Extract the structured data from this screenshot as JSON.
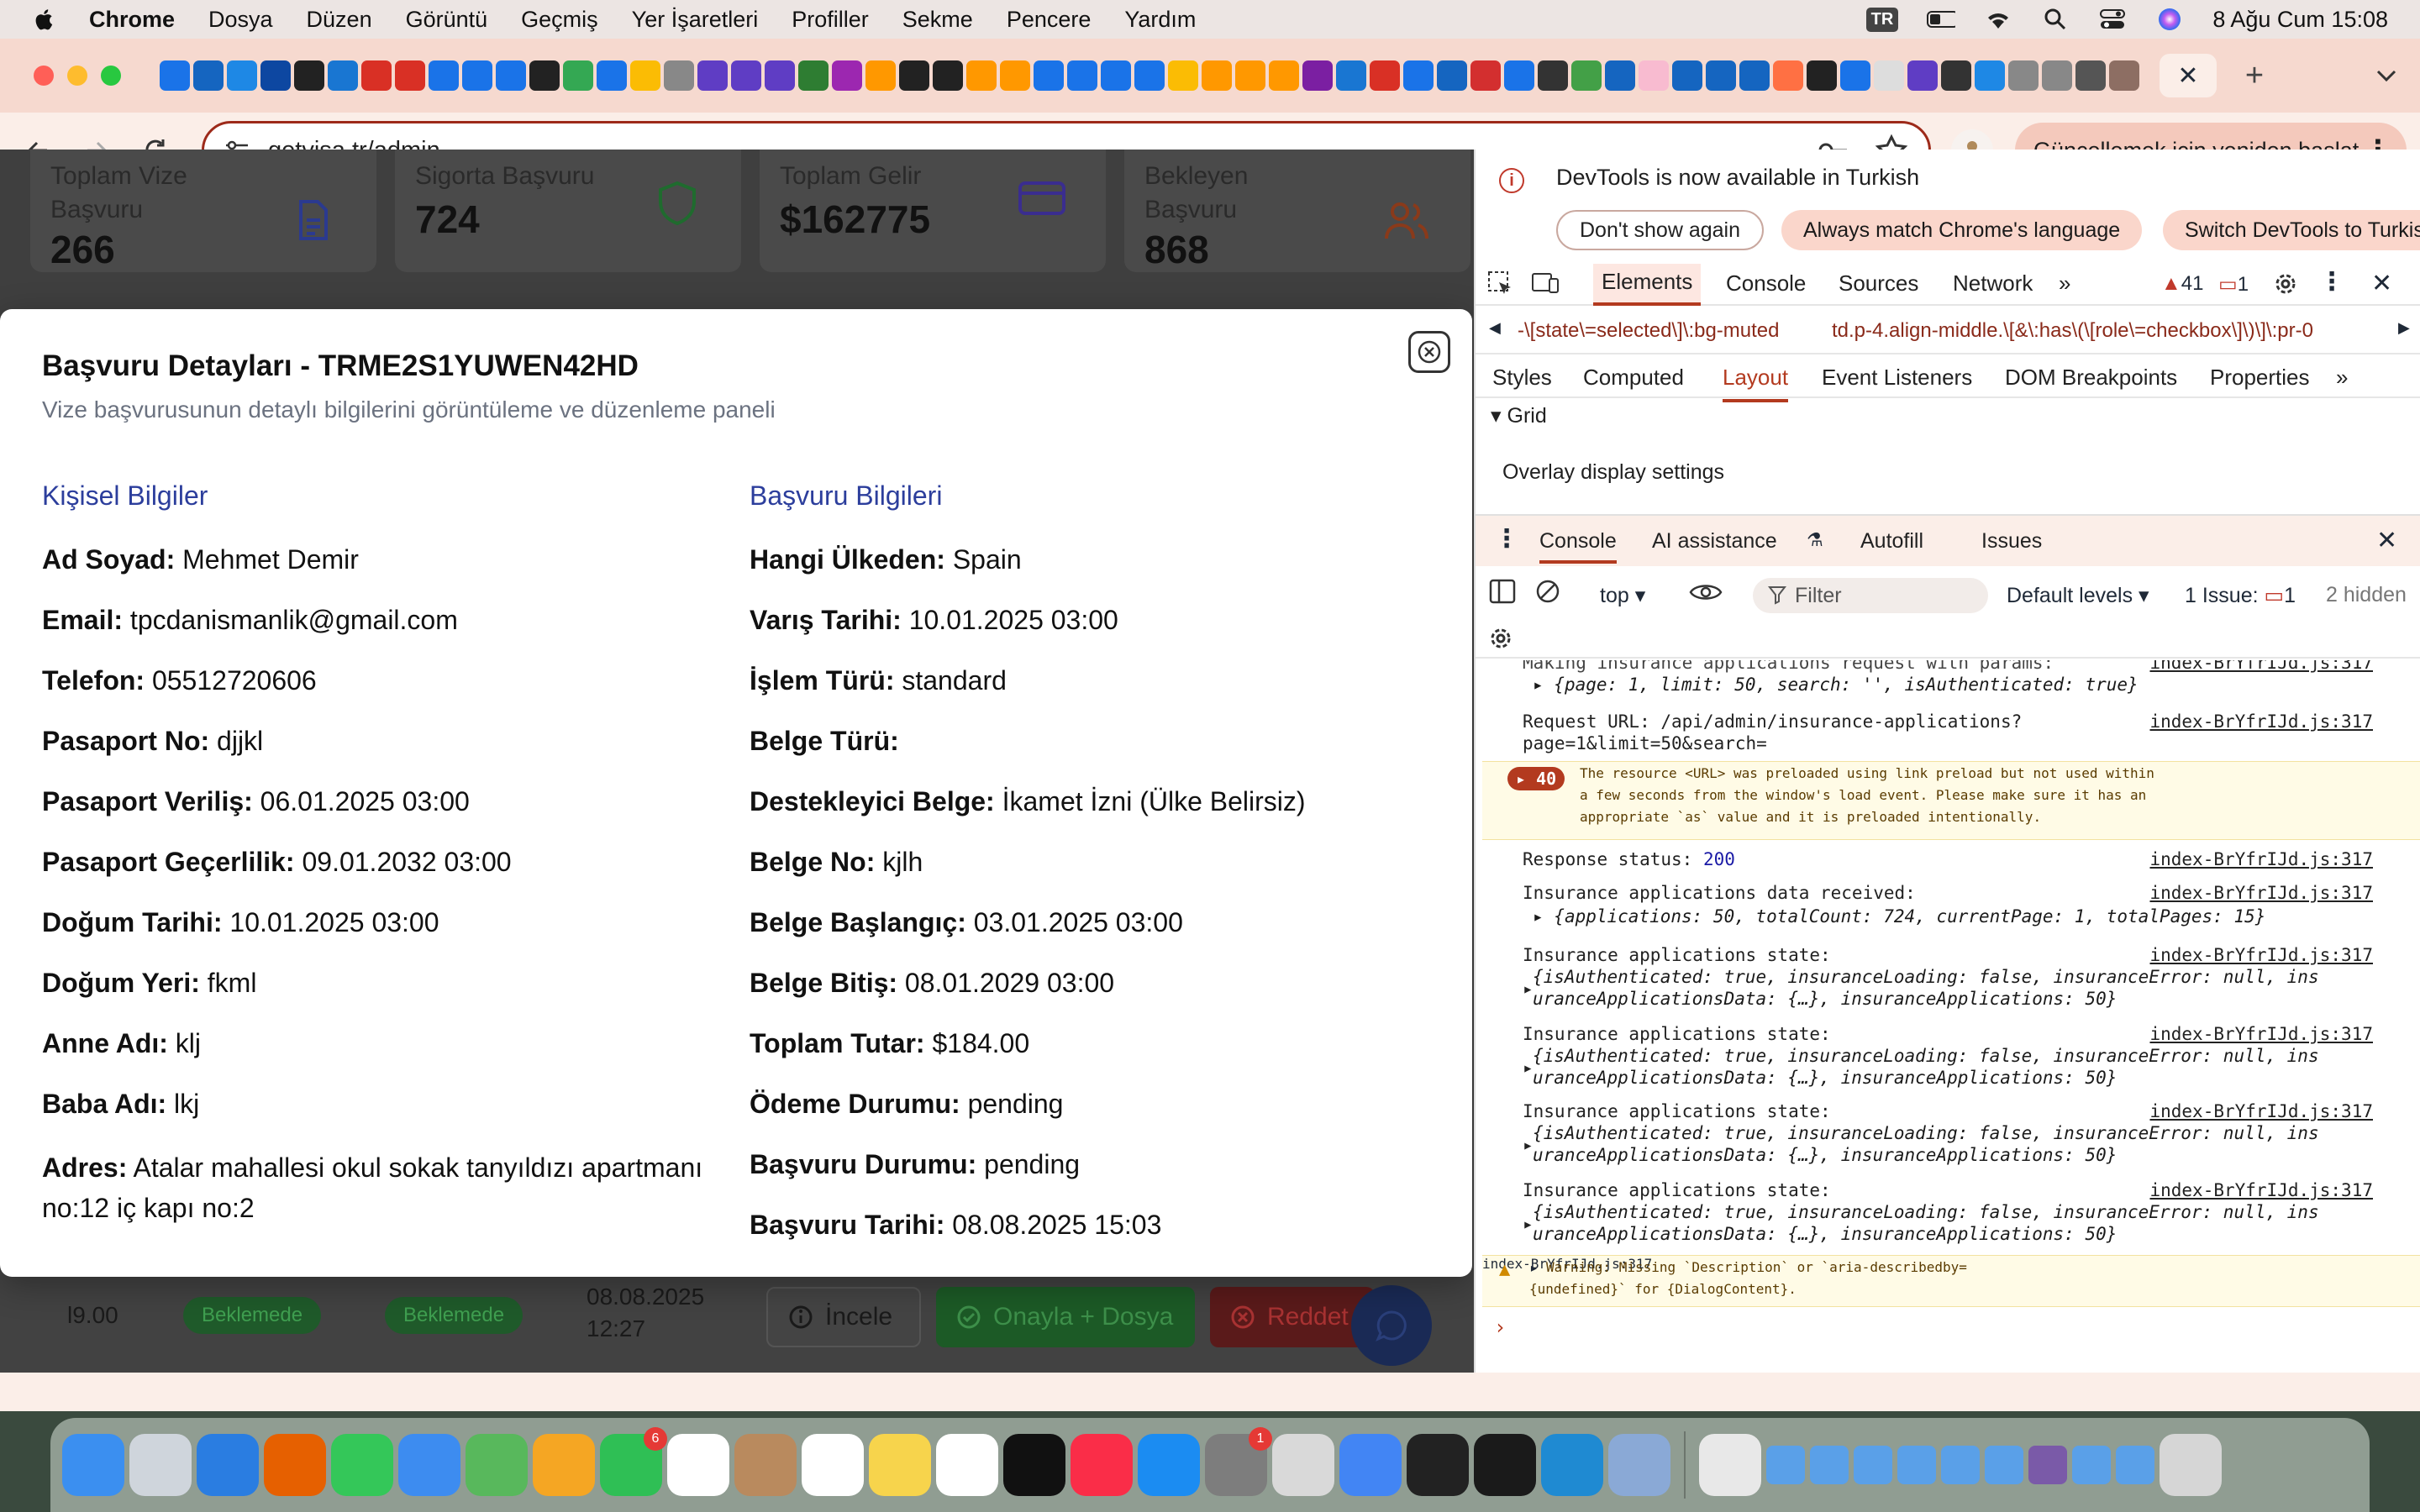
{
  "menubar": {
    "app_name": "Chrome",
    "items": [
      "Dosya",
      "Düzen",
      "Görüntü",
      "Geçmiş",
      "Yer İşaretleri",
      "Profiller",
      "Sekme",
      "Pencere",
      "Yardım"
    ],
    "input_source": "TR",
    "datetime": "8 Ağu Cum  15:08"
  },
  "browser": {
    "url": "getvisa.tr/admin",
    "relaunch_label": "Güncellemek için yeniden başlat",
    "favicon_colors": [
      "#1a73e8",
      "#1565c0",
      "#1e88e5",
      "#0d47a1",
      "#222",
      "#1976d2",
      "#d93025",
      "#d93025",
      "#1a73e8",
      "#1a73e8",
      "#1a73e8",
      "#222",
      "#34a853",
      "#1a73e8",
      "#fbbc04",
      "#888",
      "#5f3dc4",
      "#5f3dc4",
      "#5f3dc4",
      "#2e7d32",
      "#9c27b0",
      "#ff9800",
      "#222",
      "#222",
      "#ff9800",
      "#ff9800",
      "#1a73e8",
      "#1a73e8",
      "#1a73e8",
      "#1a73e8",
      "#fbbc04",
      "#ff9800",
      "#ff9800",
      "#ff9800",
      "#7b1fa2",
      "#1976d2",
      "#d93025",
      "#1a73e8",
      "#1565c0",
      "#d32f2f",
      "#1a73e8",
      "#333",
      "#43a047",
      "#1565c0",
      "#f8bbd0",
      "#1565c0",
      "#1565c0",
      "#1565c0",
      "#ff7043",
      "#222",
      "#1a73e8",
      "#ddd",
      "#5f3dc4",
      "#333",
      "#1e88e5",
      "#888",
      "#888",
      "#555",
      "#8d6e63"
    ]
  },
  "dashboard": {
    "stats": [
      {
        "label": "Toplam Vize Başvuru",
        "value": "266",
        "icon": "document-icon",
        "color": "#2b3a8f"
      },
      {
        "label": "Sigorta Başvuru",
        "value": "724",
        "icon": "shield-icon",
        "color": "#1f6b2e"
      },
      {
        "label": "Toplam Gelir",
        "value": "$162775",
        "icon": "credit-card-icon",
        "color": "#3a2d8f"
      },
      {
        "label": "Bekleyen Başvuru",
        "value": "868",
        "icon": "users-icon",
        "color": "#8a3a1a"
      }
    ],
    "row": {
      "amount": "l9.00",
      "payment_status": "Beklemede",
      "app_status": "Beklemede",
      "date": "08.08.2025",
      "time": "12:27",
      "btn_view": "İncele",
      "btn_approve": "Onayla + Dosya",
      "btn_reject": "Reddet"
    }
  },
  "modal": {
    "title": "Başvuru Detayları - TRME2S1YUWEN42HD",
    "subtitle": "Vize başvurusunun detaylı bilgilerini görüntüleme ve düzenleme paneli",
    "personal": {
      "heading": "Kişisel Bilgiler",
      "fields": [
        {
          "label": "Ad Soyad:",
          "value": "Mehmet Demir"
        },
        {
          "label": "Email:",
          "value": "tpcdanismanlik@gmail.com"
        },
        {
          "label": "Telefon:",
          "value": "05512720606"
        },
        {
          "label": "Pasaport No:",
          "value": "djjkl"
        },
        {
          "label": "Pasaport Veriliş:",
          "value": "06.01.2025 03:00"
        },
        {
          "label": "Pasaport Geçerlilik:",
          "value": "09.01.2032 03:00"
        },
        {
          "label": "Doğum Tarihi:",
          "value": "10.01.2025 03:00"
        },
        {
          "label": "Doğum Yeri:",
          "value": "fkml"
        },
        {
          "label": "Anne Adı:",
          "value": "klj"
        },
        {
          "label": "Baba Adı:",
          "value": "lkj"
        },
        {
          "label": "Adres:",
          "value": "Atalar mahallesi okul sokak tanyıldızı apartmanı no:12 iç kapı no:2"
        }
      ]
    },
    "application": {
      "heading": "Başvuru Bilgileri",
      "fields": [
        {
          "label": "Hangi Ülkeden:",
          "value": "Spain"
        },
        {
          "label": "Varış Tarihi:",
          "value": "10.01.2025 03:00"
        },
        {
          "label": "İşlem Türü:",
          "value": "standard"
        },
        {
          "label": "Belge Türü:",
          "value": ""
        },
        {
          "label": "Destekleyici Belge:",
          "value": "İkamet İzni (Ülke Belirsiz)"
        },
        {
          "label": "Belge No:",
          "value": "kjlh"
        },
        {
          "label": "Belge Başlangıç:",
          "value": "03.01.2025 03:00"
        },
        {
          "label": "Belge Bitiş:",
          "value": "08.01.2029 03:00"
        },
        {
          "label": "Toplam Tutar:",
          "value": "$184.00"
        },
        {
          "label": "Ödeme Durumu:",
          "value": "pending"
        },
        {
          "label": "Başvuru Durumu:",
          "value": "pending"
        },
        {
          "label": "Başvuru Tarihi:",
          "value": "08.08.2025 15:03"
        }
      ]
    }
  },
  "devtools": {
    "info_message": "DevTools is now available in Turkish",
    "btn_dont_show": "Don't show again",
    "btn_match": "Always match Chrome's language",
    "btn_switch": "Switch DevTools to Turkish",
    "tabs": [
      "Elements",
      "Console",
      "Sources",
      "Network"
    ],
    "warn_count": "41",
    "msg_count": "1",
    "breadcrumb_1": "-\\[state\\=selected\\]\\:bg-muted",
    "breadcrumb_2": "td.p-4.align-middle.\\[&\\:has\\(\\[role\\=checkbox\\]\\)\\]\\:pr-0",
    "subtabs": [
      "Styles",
      "Computed",
      "Layout",
      "Event Listeners",
      "DOM Breakpoints",
      "Properties"
    ],
    "grid_label": "Grid",
    "overlay_label": "Overlay display settings",
    "drawer_tabs": [
      "Console",
      "AI assistance",
      "Autofill",
      "Issues"
    ],
    "context": "top",
    "filter_placeholder": "Filter",
    "levels": "Default levels",
    "issues": "1 Issue:",
    "issues_count": "1",
    "hidden": "2 hidden",
    "source_file": "index-BrYfrIJd.js:317",
    "logs": {
      "cut_line": "Making insurance applications request with params:",
      "params_obj": "{page: 1, limit: 50, search: '', isAuthenticated: true}",
      "request_url_1": "Request URL: /api/admin/insurance-applications?",
      "request_url_2": "page=1&limit=50&search=",
      "error_count": "40",
      "error_1": "The resource <URL> was preloaded using link preload but not used within",
      "error_2": "a few seconds from the window's load event. Please make sure it has an",
      "error_3": "appropriate `as` value and it is preloaded intentionally.",
      "response_status": "Response status:",
      "response_code": "200",
      "data_received": "Insurance applications data received:",
      "data_obj": "{applications: 50, totalCount: 724, currentPage: 1, totalPages: 15}",
      "state_label": "Insurance applications state:",
      "state_obj_1": "{isAuthenticated: true, insuranceLoading: false, insuranceError: null, ins",
      "state_obj_2": "uranceApplicationsData: {…}, insuranceApplications: 50}",
      "warning_1": "Warning: Missing `Description` or `aria-describedby=",
      "warning_2": "{undefined}` for {DialogContent}."
    }
  },
  "dock": {
    "apps": [
      {
        "name": "finder-icon",
        "color": "#3b8ff0"
      },
      {
        "name": "launchpad-icon",
        "color": "#cfd5dc"
      },
      {
        "name": "safari-icon",
        "color": "#2a7de1"
      },
      {
        "name": "firefox-icon",
        "color": "#e66000"
      },
      {
        "name": "messages-icon",
        "color": "#34c759"
      },
      {
        "name": "mail-icon",
        "color": "#3d8cf0"
      },
      {
        "name": "maps-icon",
        "color": "#58b85c"
      },
      {
        "name": "photos-icon",
        "color": "#f5a623"
      },
      {
        "name": "facetime-icon",
        "color": "#2fbf55",
        "badge": "6"
      },
      {
        "name": "calendar-icon",
        "color": "#ffffff"
      },
      {
        "name": "contacts-icon",
        "color": "#b98a5e"
      },
      {
        "name": "reminders-icon",
        "color": "#ffffff"
      },
      {
        "name": "notes-icon",
        "color": "#f7d44c"
      },
      {
        "name": "freeform-icon",
        "color": "#ffffff"
      },
      {
        "name": "tv-icon",
        "color": "#111111"
      },
      {
        "name": "music-icon",
        "color": "#fa2d48"
      },
      {
        "name": "app-store-icon",
        "color": "#1b8cf2"
      },
      {
        "name": "system-settings-icon",
        "color": "#7d7d7d",
        "badge": "1"
      },
      {
        "name": "iphone-mirroring-icon",
        "color": "#d9d9d9"
      },
      {
        "name": "chrome-icon",
        "color": "#4285f4"
      },
      {
        "name": "terminal-icon",
        "color": "#222222"
      },
      {
        "name": "cube-app-icon",
        "color": "#1a1a1a"
      },
      {
        "name": "vscode-icon",
        "color": "#1f8ad2"
      },
      {
        "name": "preview-icon",
        "color": "#8aa9d6"
      },
      {
        "name": "document-stack-icon",
        "color": "#e8e8e8"
      },
      {
        "name": "folder-icon",
        "color": "#5aa0e8"
      },
      {
        "name": "folder-icon",
        "color": "#5aa0e8"
      },
      {
        "name": "folder-icon",
        "color": "#5aa0e8"
      },
      {
        "name": "folder-icon",
        "color": "#5aa0e8"
      },
      {
        "name": "folder-icon",
        "color": "#5aa0e8"
      },
      {
        "name": "folder-icon",
        "color": "#5aa0e8"
      },
      {
        "name": "folder-icon",
        "color": "#7a5aa8"
      },
      {
        "name": "folder-icon",
        "color": "#5aa0e8"
      },
      {
        "name": "folder-icon",
        "color": "#5aa0e8"
      },
      {
        "name": "trash-icon",
        "color": "#d6d6d6"
      }
    ]
  }
}
